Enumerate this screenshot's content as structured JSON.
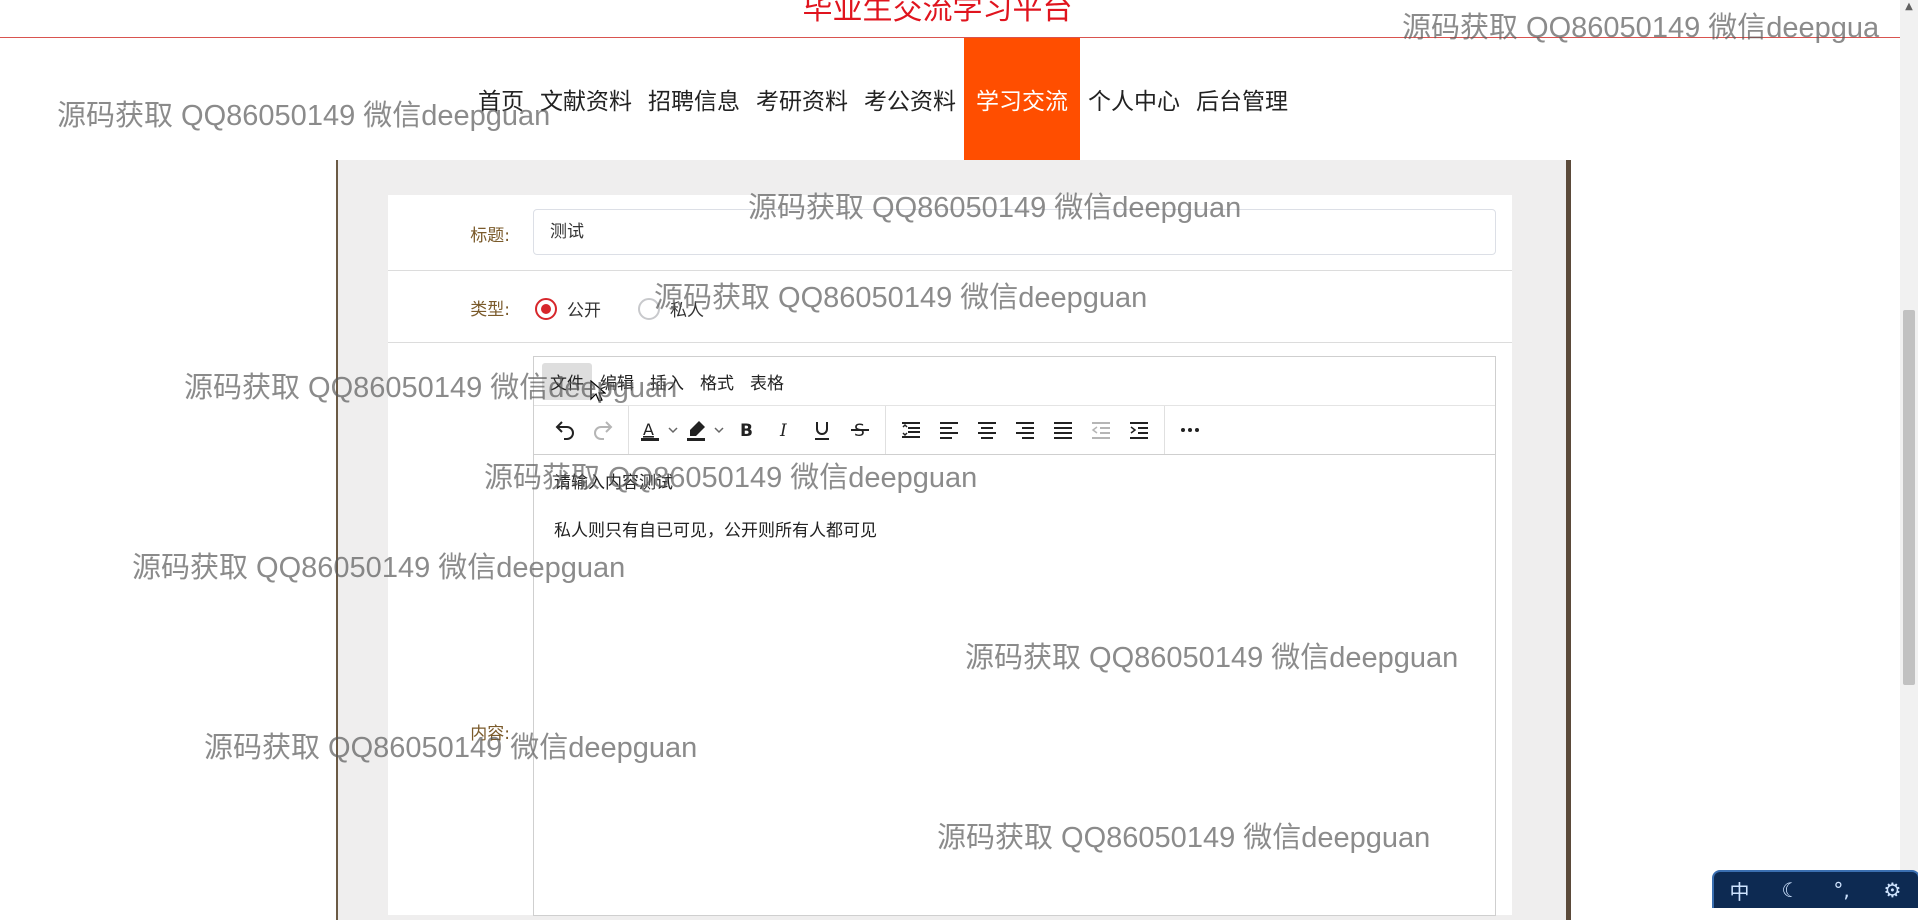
{
  "site": {
    "title": "毕业生交流学习平台"
  },
  "nav": {
    "items": [
      {
        "label": "首页",
        "active": false
      },
      {
        "label": "文献资料",
        "active": false
      },
      {
        "label": "招聘信息",
        "active": false
      },
      {
        "label": "考研资料",
        "active": false
      },
      {
        "label": "考公资料",
        "active": false
      },
      {
        "label": "学习交流",
        "active": true
      },
      {
        "label": "个人中心",
        "active": false
      },
      {
        "label": "后台管理",
        "active": false
      }
    ],
    "active_color": "#ff4e00"
  },
  "form": {
    "title_label": "标题:",
    "title_value": "测试",
    "type_label": "类型:",
    "type_options": [
      {
        "label": "公开",
        "checked": true
      },
      {
        "label": "私人",
        "checked": false
      }
    ],
    "content_label": "内容:"
  },
  "editor": {
    "menus": [
      "文件",
      "编辑",
      "插入",
      "格式",
      "表格"
    ],
    "toolbar_icons": [
      "undo-icon",
      "redo-icon",
      "font-color-icon",
      "highlight-icon",
      "bold-icon",
      "italic-icon",
      "underline-icon",
      "strikethrough-icon",
      "line-height-icon",
      "align-left-icon",
      "align-center-icon",
      "align-right-icon",
      "align-justify-icon",
      "outdent-icon",
      "indent-icon",
      "more-icon"
    ],
    "paragraphs": [
      "请输入内容测试",
      "私人则只有自已可见，公开则所有人都可见"
    ]
  },
  "watermark": {
    "text": "源码获取 QQ86050149 微信deepguan",
    "text_cut": "源码获取 QQ86050149 微信deepgua"
  },
  "tray": {
    "ime": "中"
  },
  "colors": {
    "title_red": "#e0141e",
    "radio_red": "#d7262b",
    "label_brown": "#7a5a2a"
  }
}
